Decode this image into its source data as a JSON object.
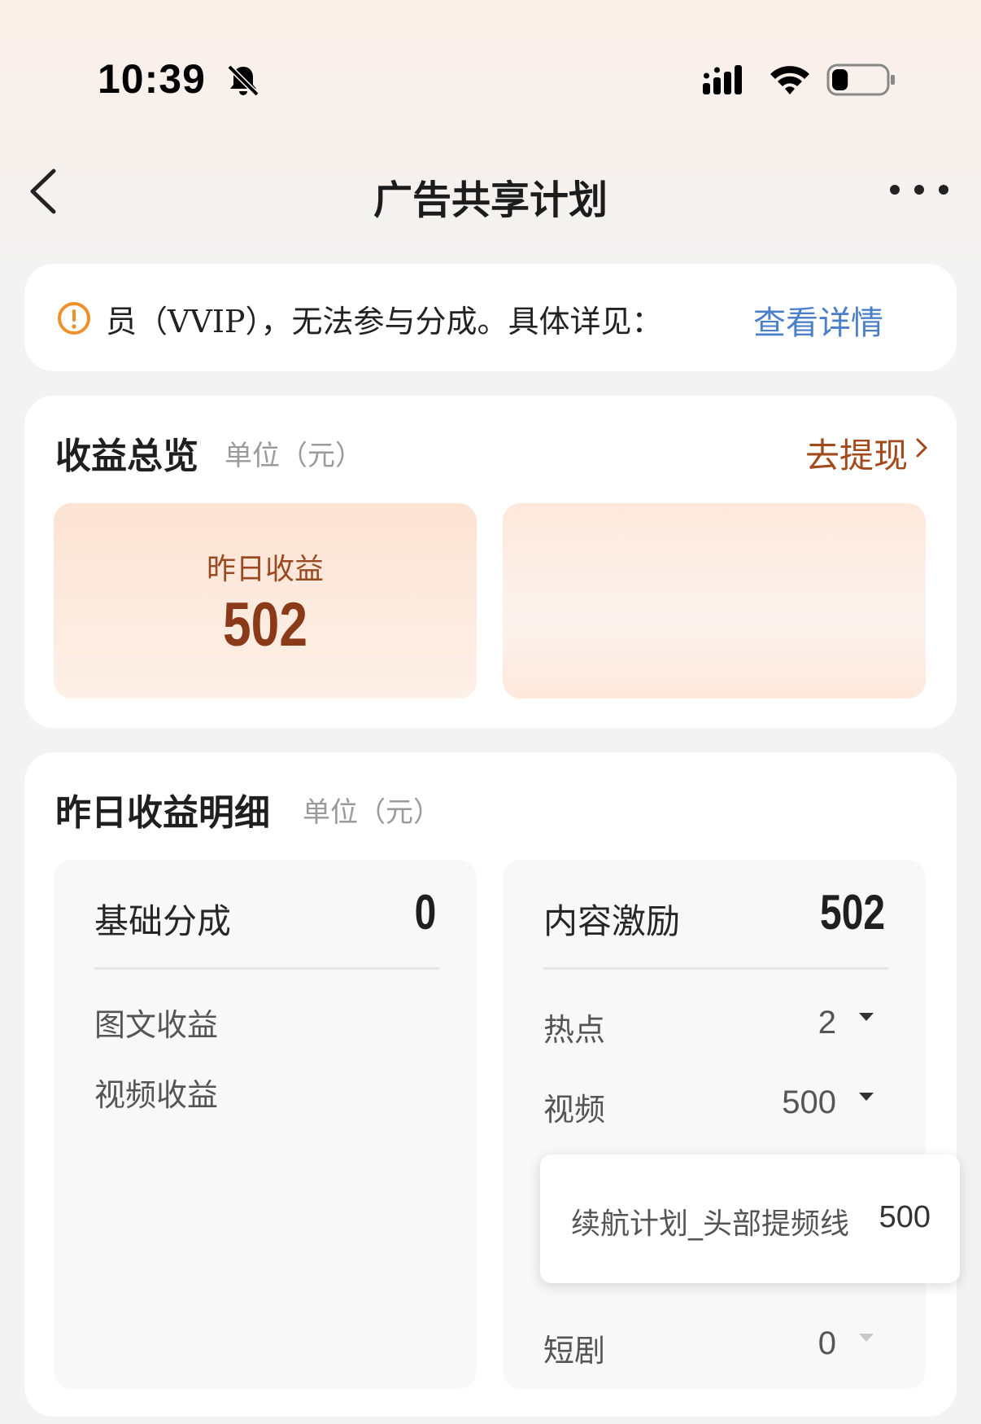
{
  "status_bar": {
    "time": "10:39",
    "icons": [
      "bell-slash-icon",
      "signal-icon",
      "wifi-icon",
      "battery-icon"
    ],
    "battery_level": 0.3
  },
  "nav": {
    "title": "广告共享计划",
    "back_icon": "chevron-left-icon",
    "more_icon": "more-dots-icon"
  },
  "notice": {
    "icon": "warning-circle-icon",
    "text": "员（VVIP），无法参与分成。具体详见：",
    "link": "查看详情"
  },
  "overview": {
    "title": "收益总览",
    "unit": "单位（元）",
    "withdraw": "去提现",
    "yesterday_label": "昨日收益",
    "yesterday_value": "502"
  },
  "detail": {
    "title": "昨日收益明细",
    "unit": "单位（元）",
    "base": {
      "label": "基础分成",
      "value": "0",
      "rows": [
        {
          "label": "图文收益"
        },
        {
          "label": "视频收益"
        }
      ]
    },
    "content": {
      "label": "内容激励",
      "value": "502",
      "rows": [
        {
          "label": "热点",
          "value": "2"
        },
        {
          "label": "视频",
          "value": "500"
        },
        {
          "label": "短剧",
          "value": "0"
        }
      ]
    },
    "tooltip": {
      "label": "续航计划_头部提频线",
      "value": "500"
    }
  },
  "colors": {
    "accent_brown": "#a34a1c",
    "value_brown": "#8a3a18",
    "link_blue": "#4c7fc9",
    "warning_orange": "#f0902a"
  }
}
